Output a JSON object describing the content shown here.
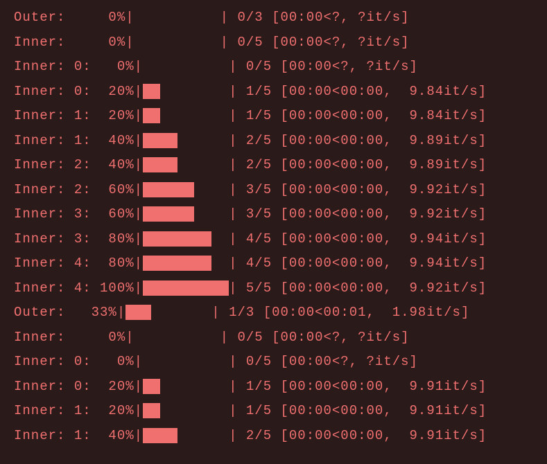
{
  "lines": [
    {
      "label": "Outer:   ",
      "pct": "  0%",
      "filled": 0,
      "total": 10,
      "stats": " 0/3 [00:00<?, ?it/s]"
    },
    {
      "label": "Inner:   ",
      "pct": "  0%",
      "filled": 0,
      "total": 10,
      "stats": " 0/5 [00:00<?, ?it/s]"
    },
    {
      "label": "Inner: 0:",
      "pct": "   0%",
      "filled": 0,
      "total": 10,
      "stats": " 0/5 [00:00<?, ?it/s]"
    },
    {
      "label": "Inner: 0:",
      "pct": "  20%",
      "filled": 2,
      "total": 10,
      "stats": " 1/5 [00:00<00:00,  9.84it/s]"
    },
    {
      "label": "Inner: 1:",
      "pct": "  20%",
      "filled": 2,
      "total": 10,
      "stats": " 1/5 [00:00<00:00,  9.84it/s]"
    },
    {
      "label": "Inner: 1:",
      "pct": "  40%",
      "filled": 4,
      "total": 10,
      "stats": " 2/5 [00:00<00:00,  9.89it/s]"
    },
    {
      "label": "Inner: 2:",
      "pct": "  40%",
      "filled": 4,
      "total": 10,
      "stats": " 2/5 [00:00<00:00,  9.89it/s]"
    },
    {
      "label": "Inner: 2:",
      "pct": "  60%",
      "filled": 6,
      "total": 10,
      "stats": " 3/5 [00:00<00:00,  9.92it/s]"
    },
    {
      "label": "Inner: 3:",
      "pct": "  60%",
      "filled": 6,
      "total": 10,
      "stats": " 3/5 [00:00<00:00,  9.92it/s]"
    },
    {
      "label": "Inner: 3:",
      "pct": "  80%",
      "filled": 8,
      "total": 10,
      "stats": " 4/5 [00:00<00:00,  9.94it/s]"
    },
    {
      "label": "Inner: 4:",
      "pct": "  80%",
      "filled": 8,
      "total": 10,
      "stats": " 4/5 [00:00<00:00,  9.94it/s]"
    },
    {
      "label": "Inner: 4:",
      "pct": " 100%",
      "filled": 10,
      "total": 10,
      "stats": " 5/5 [00:00<00:00,  9.92it/s]"
    },
    {
      "label": "Outer:  ",
      "pct": " 33%",
      "filled": 3,
      "total": 10,
      "stats": " 1/3 [00:00<00:01,  1.98it/s]"
    },
    {
      "label": "Inner:   ",
      "pct": "  0%",
      "filled": 0,
      "total": 10,
      "stats": " 0/5 [00:00<?, ?it/s]"
    },
    {
      "label": "Inner: 0:",
      "pct": "   0%",
      "filled": 0,
      "total": 10,
      "stats": " 0/5 [00:00<?, ?it/s]"
    },
    {
      "label": "Inner: 0:",
      "pct": "  20%",
      "filled": 2,
      "total": 10,
      "stats": " 1/5 [00:00<00:00,  9.91it/s]"
    },
    {
      "label": "Inner: 1:",
      "pct": "  20%",
      "filled": 2,
      "total": 10,
      "stats": " 1/5 [00:00<00:00,  9.91it/s]"
    },
    {
      "label": "Inner: 1:",
      "pct": "  40%",
      "filled": 4,
      "total": 10,
      "stats": " 2/5 [00:00<00:00,  9.91it/s]"
    }
  ]
}
